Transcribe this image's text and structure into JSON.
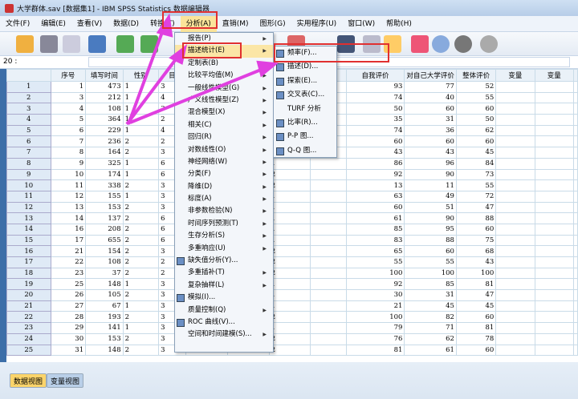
{
  "title": "大学群体.sav [数据集1] - IBM SPSS Statistics 数据编辑器",
  "menubar": [
    "文件(F)",
    "编辑(E)",
    "查看(V)",
    "数据(D)",
    "转换(T)",
    "分析(A)",
    "直销(M)",
    "图形(G)",
    "实用程序(U)",
    "窗口(W)",
    "帮助(H)"
  ],
  "cell_ref": "20 :",
  "columns": [
    "序号",
    "填写时间",
    "性别",
    "目",
    "",
    "",
    "",
    "",
    "自我评价",
    "对自己大学评价",
    "整体评价",
    "变量",
    "变量"
  ],
  "rows": [
    [
      "1",
      "473",
      "1",
      "3",
      "93",
      "77",
      "52"
    ],
    [
      "3",
      "212",
      "1",
      "4",
      "74",
      "40",
      "55"
    ],
    [
      "4",
      "108",
      "1",
      "3",
      "50",
      "60",
      "60"
    ],
    [
      "5",
      "364",
      "1",
      "2",
      "35",
      "31",
      "50"
    ],
    [
      "6",
      "229",
      "1",
      "4",
      "74",
      "36",
      "62"
    ],
    [
      "7",
      "236",
      "2",
      "2",
      "60",
      "60",
      "60"
    ],
    [
      "8",
      "164",
      "2",
      "3",
      "43",
      "43",
      "45"
    ],
    [
      "9",
      "325",
      "1",
      "6",
      "86",
      "96",
      "84"
    ],
    [
      "10",
      "174",
      "1",
      "6",
      "92",
      "90",
      "73"
    ],
    [
      "11",
      "338",
      "2",
      "3",
      "13",
      "11",
      "55"
    ],
    [
      "12",
      "155",
      "1",
      "3",
      "63",
      "49",
      "72"
    ],
    [
      "13",
      "153",
      "2",
      "3",
      "60",
      "51",
      "47"
    ],
    [
      "14",
      "137",
      "2",
      "6",
      "61",
      "90",
      "88"
    ],
    [
      "16",
      "208",
      "2",
      "6",
      "85",
      "95",
      "60"
    ],
    [
      "17",
      "655",
      "2",
      "6",
      "83",
      "88",
      "75"
    ],
    [
      "21",
      "154",
      "2",
      "3",
      "65",
      "60",
      "68"
    ],
    [
      "22",
      "108",
      "2",
      "2",
      "55",
      "55",
      "43"
    ],
    [
      "23",
      "37",
      "2",
      "2",
      "100",
      "100",
      "100"
    ],
    [
      "25",
      "148",
      "1",
      "3",
      "92",
      "85",
      "81"
    ],
    [
      "26",
      "105",
      "2",
      "3",
      "30",
      "31",
      "47"
    ],
    [
      "27",
      "67",
      "1",
      "3",
      "21",
      "45",
      "45"
    ],
    [
      "28",
      "193",
      "2",
      "3",
      "100",
      "82",
      "60"
    ],
    [
      "29",
      "141",
      "1",
      "3",
      "79",
      "71",
      "81"
    ],
    [
      "30",
      "153",
      "2",
      "3",
      "76",
      "62",
      "78"
    ],
    [
      "31",
      "148",
      "2",
      "3",
      "81",
      "61",
      "60"
    ]
  ],
  "hidden_col": [
    "",
    "",
    "",
    "",
    "",
    "",
    "",
    "1",
    "2",
    "2",
    "1",
    "1",
    "1",
    "1",
    "1",
    "2",
    "2",
    "2",
    "1",
    "1",
    "1",
    "2",
    "1",
    "2",
    "2"
  ],
  "analysis_menu": [
    {
      "label": "报告(P)",
      "sub": true
    },
    {
      "label": "描述统计(E)",
      "sub": true,
      "hl": true
    },
    {
      "label": "定制表(B)",
      "sub": true
    },
    {
      "label": "比较平均值(M)",
      "sub": true
    },
    {
      "label": "一般线性模型(G)",
      "sub": true
    },
    {
      "label": "广义线性模型(Z)",
      "sub": true
    },
    {
      "label": "混合模型(X)",
      "sub": true
    },
    {
      "label": "相关(C)",
      "sub": true
    },
    {
      "label": "回归(R)",
      "sub": true
    },
    {
      "label": "对数线性(O)",
      "sub": true
    },
    {
      "label": "神经网络(W)",
      "sub": true
    },
    {
      "label": "分类(F)",
      "sub": true
    },
    {
      "label": "降维(D)",
      "sub": true
    },
    {
      "label": "标度(A)",
      "sub": true
    },
    {
      "label": "非参数检验(N)",
      "sub": true
    },
    {
      "label": "时间序列预测(T)",
      "sub": true
    },
    {
      "label": "生存分析(S)",
      "sub": true
    },
    {
      "label": "多重响应(U)",
      "sub": true
    },
    {
      "label": "缺失值分析(Y)...",
      "icon": true
    },
    {
      "label": "多重插补(T)",
      "sub": true
    },
    {
      "label": "复杂抽样(L)",
      "sub": true
    },
    {
      "label": "模拟(I)...",
      "icon": true
    },
    {
      "label": "质量控制(Q)",
      "sub": true
    },
    {
      "label": "ROC 曲线(V)...",
      "icon": true
    },
    {
      "label": "空间和时间建模(S)...",
      "sub": true
    }
  ],
  "descriptive_submenu": [
    {
      "label": "频率(F)...",
      "icon": true
    },
    {
      "label": "描述(D)...",
      "icon": true
    },
    {
      "label": "探索(E)...",
      "icon": true
    },
    {
      "label": "交叉表(C)...",
      "icon": true
    },
    {
      "label": "TURF 分析",
      "icon": false
    },
    {
      "label": "比率(R)...",
      "icon": true
    },
    {
      "label": "P-P 图...",
      "icon": true
    },
    {
      "label": "Q-Q 图...",
      "icon": true
    }
  ],
  "tabs": [
    "数据视图",
    "变量视图"
  ],
  "colors": {
    "highlight": "#fbe6a6",
    "annotation": "#e040e0",
    "box": "#e03030"
  }
}
